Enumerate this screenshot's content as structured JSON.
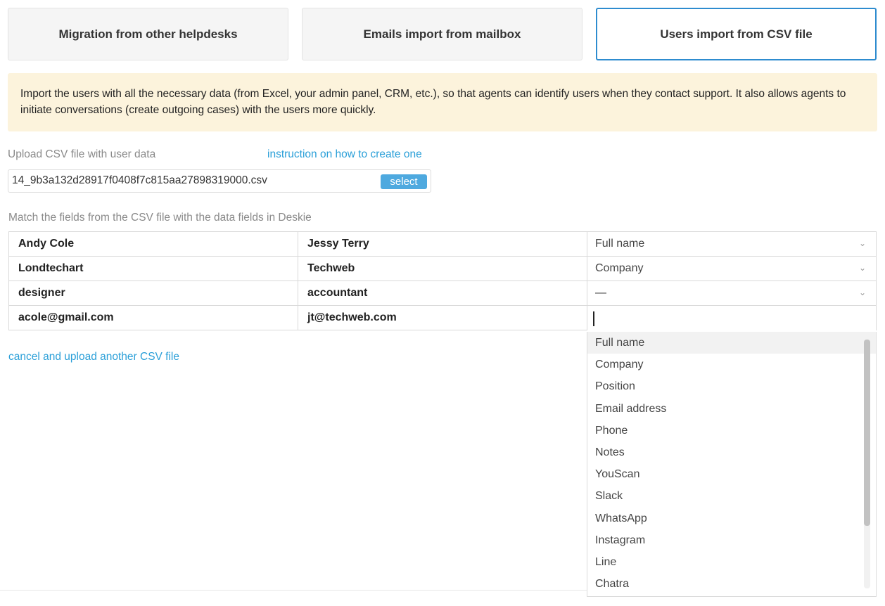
{
  "tabs": [
    {
      "label": "Migration from other helpdesks"
    },
    {
      "label": "Emails import from mailbox"
    },
    {
      "label": "Users import from CSV file"
    }
  ],
  "banner": {
    "text": "Import the users with all the necessary data (from Excel, your admin panel, CRM, etc.), so that agents can identify users when they contact support. It also allows agents to initiate conversations (create outgoing cases) with the users more quickly."
  },
  "upload": {
    "label": "Upload CSV file with user data",
    "instruction_link": "instruction on how to create one",
    "filename": "14_9b3a132d28917f0408f7c815aa27898319000.csv",
    "select_label": "select"
  },
  "match": {
    "label": "Match the fields from the CSV file with the data fields in Deskie",
    "rows": [
      {
        "col1": "Andy Cole",
        "col2": "Jessy Terry",
        "field": "Full name"
      },
      {
        "col1": "Londtechart",
        "col2": "Techweb",
        "field": "Company"
      },
      {
        "col1": "designer",
        "col2": "accountant",
        "field": "—"
      },
      {
        "col1": "acole@gmail.com",
        "col2": "jt@techweb.com",
        "field": ""
      }
    ]
  },
  "cancel_link": "cancel and upload another CSV file",
  "dropdown": {
    "options": [
      "Full name",
      "Company",
      "Position",
      "Email address",
      "Phone",
      "Notes",
      "YouScan",
      "Slack",
      "WhatsApp",
      "Instagram",
      "Line",
      "Chatra"
    ]
  },
  "colors": {
    "accent": "#2e8ccf",
    "link": "#2a9fd8",
    "banner_bg": "#fcf3dc",
    "button_bg": "#4ea9df"
  }
}
